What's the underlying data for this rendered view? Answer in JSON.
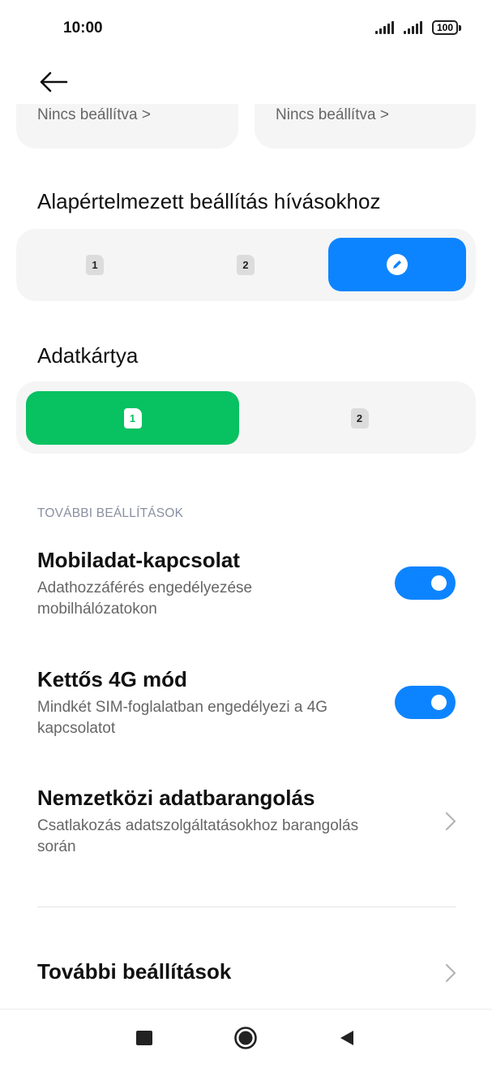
{
  "status_bar": {
    "time": "10:00",
    "battery": "100",
    "icons": [
      "signal-sim1-icon",
      "signal-sim2-icon",
      "battery-icon"
    ]
  },
  "header": {
    "back_icon": "arrow-left-icon"
  },
  "sim_cards": [
    {
      "label": "Nincs beállítva >"
    },
    {
      "label": "Nincs beállítva >"
    }
  ],
  "calls_default": {
    "title": "Alapértelmezett beállítás hívásokhoz",
    "options": [
      {
        "label": "1",
        "selected": false
      },
      {
        "label": "2",
        "selected": false
      },
      {
        "icon": "pencil-circle-icon",
        "selected": true
      }
    ]
  },
  "data_card": {
    "title": "Adatkártya",
    "options": [
      {
        "label": "1",
        "selected": true
      },
      {
        "label": "2",
        "selected": false
      }
    ]
  },
  "more_settings_section": {
    "caption": "TOVÁBBI BEÁLLÍTÁSOK",
    "mobile_data": {
      "title": "Mobiladat-kapcsolat",
      "line1": "Adathozzáférés engedélyezése",
      "line2": "mobilhálózatokon",
      "enabled": true
    },
    "dual_4g": {
      "title": "Kettős 4G mód",
      "line1": "Mindkét SIM-foglalatban engedélyezi a 4G",
      "line2": "kapcsolatot",
      "enabled": true
    },
    "roaming": {
      "title": "Nemzetközi adatbarangolás",
      "line1": "Csatlakozás adatszolgáltatásokhoz barangolás",
      "line2": "során"
    },
    "more": {
      "title": "További beállítások"
    }
  },
  "nav_bar": {
    "icons": [
      "square-icon",
      "home-circle-icon",
      "back-triangle-icon"
    ]
  },
  "colors": {
    "accent_blue": "#0d84ff",
    "accent_green": "#08c160"
  }
}
